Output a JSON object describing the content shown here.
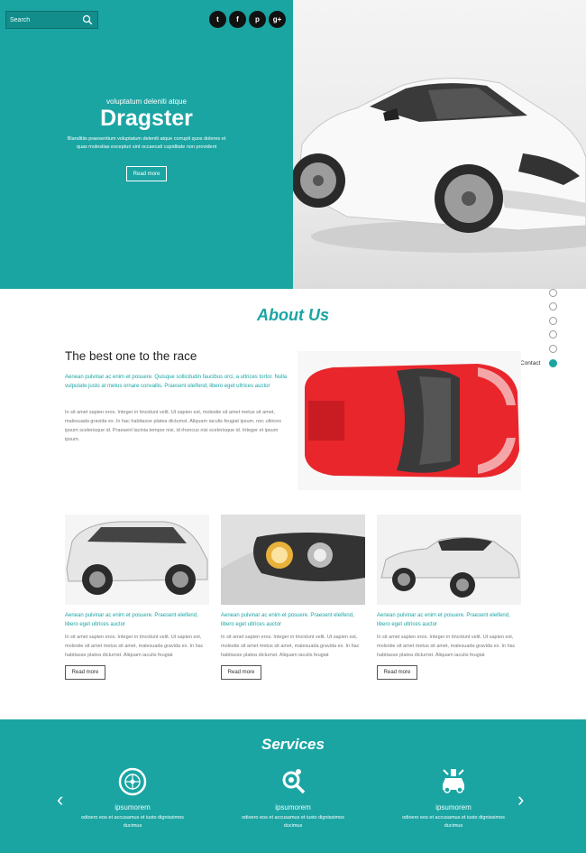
{
  "search": {
    "placeholder": "Search"
  },
  "social": [
    {
      "icon": "twitter-icon",
      "glyph": "t"
    },
    {
      "icon": "facebook-icon",
      "glyph": "f"
    },
    {
      "icon": "pinterest-icon",
      "glyph": "p"
    },
    {
      "icon": "google-plus-icon",
      "glyph": "g+"
    }
  ],
  "hero": {
    "subtitle": "voluptatum deleniti atque",
    "title": "Dragster",
    "text": "Blanditiis praesentium voluptatum deleniti atque corrupti quos dolores et quas molestias excepturi sint occaecati cupiditate non provident",
    "button": "Read more"
  },
  "nav": {
    "active_label": "Contact",
    "count": 6,
    "active_index": 5
  },
  "about": {
    "title": "About Us",
    "heading": "The best one to the race",
    "teal_text": "Aenean pulvinar ac enim et posuere. Quisque sollicitudin faucibus orci, a ultrices tortor. Nulla vulputate justo at metus ornare convallis. Praesent eleifend, libero eget ultrices auctor",
    "body": "In sit amet sapien eros. Integer in tincidunt velit. Ut sapien est, molestie sit amet metus sit amet, malesuada gravida ex. In hac habitasse platea dictumst. Aliquam iaculis feugiat ipsum, nec ultrices ipsum scelerisque id. Praesent lacinia tempor nisi, id rhoncus nisi scelerisque id. Integer et ipsum ipsum."
  },
  "cards": [
    {
      "teal_text": "Aenean pulvinar ac enim et posuere. Praesent eleifend, libero eget ultrices auctor",
      "body": "In sit amet sapien eros. Integer in tincidunt velit. Ut sapien est, molestie sit amet metus sit amet, malesuada gravida ex. In hac habitasse platea dictumst. Aliquam iaculis feugiat",
      "button": "Read more"
    },
    {
      "teal_text": "Aenean pulvinar ac enim et posuere. Praesent eleifend, libero eget ultrices auctor",
      "body": "In sit amet sapien eros. Integer in tincidunt velit. Ut sapien est, molestie sit amet metus sit amet, malesuada gravida ex. In hac habitasse platea dictumst. Aliquam iaculis feugiat",
      "button": "Read more"
    },
    {
      "teal_text": "Aenean pulvinar ac enim et posuere. Praesent eleifend, libero eget ultrices auctor",
      "body": "In sit amet sapien eros. Integer in tincidunt velit. Ut sapien est, molestie sit amet metus sit amet, malesuada gravida ex. In hac habitasse platea dictumst. Aliquam iaculis feugiat",
      "button": "Read more"
    }
  ],
  "services": {
    "title": "Services",
    "items": [
      {
        "icon": "wheel-icon",
        "title": "ipsumorem",
        "text": "odioero eos et accusamus et iusto dignissimos ducimus"
      },
      {
        "icon": "search-gear-icon",
        "title": "ipsumorem",
        "text": "odioero eos et accusamus et iusto dignissimos ducimus"
      },
      {
        "icon": "car-service-icon",
        "title": "ipsumorem",
        "text": "odioero eos et accusamus et iusto dignissimos ducimus"
      }
    ]
  },
  "colors": {
    "accent": "#1aa5a3",
    "dark": "#111111"
  }
}
